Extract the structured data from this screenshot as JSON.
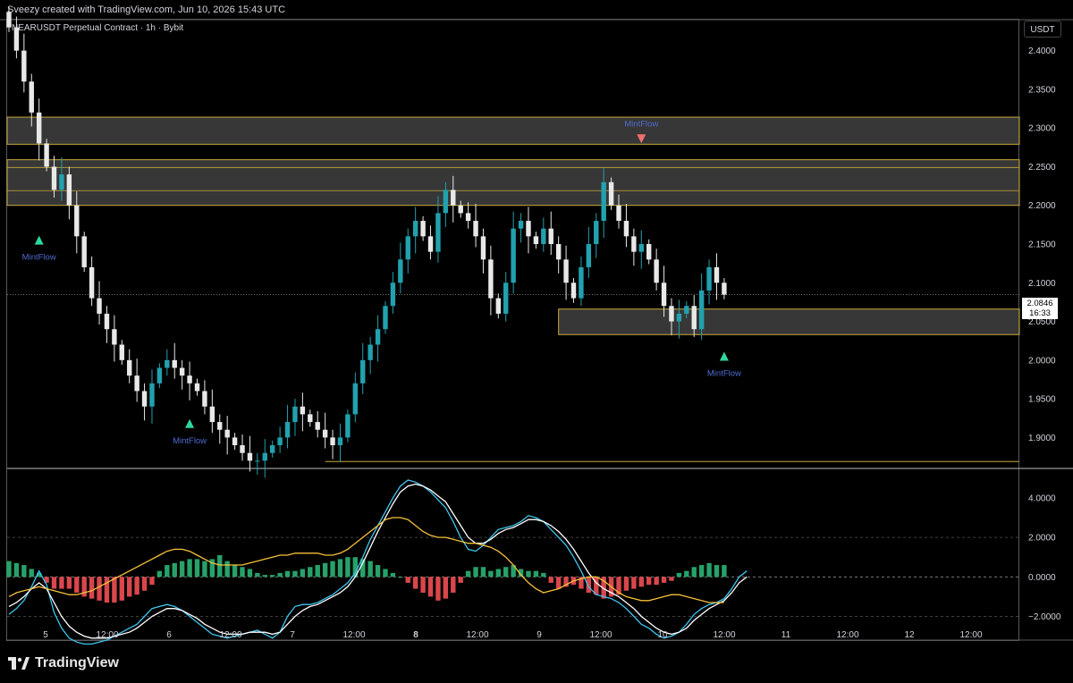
{
  "header": {
    "attribution": "Sveezy created with TradingView.com, Jun 10, 2026 15:43 UTC"
  },
  "chart": {
    "symbol_label": "NEARUSDT Perpetual Contract · 1h · Bybit",
    "currency": "USDT",
    "last_price": "2.0846",
    "countdown": "16:33",
    "colors": {
      "up": "#22a1ae",
      "down": "#e8e8e8",
      "zone": "#c8a93a",
      "macd_fast": "#3ec6f0",
      "macd_slow": "#ffffff",
      "signal": "#f7c23a",
      "hist_pos": "#26a269",
      "hist_neg": "#d9464c",
      "mint_up": "#2fd6a0",
      "mint_down": "#f07070",
      "mint_text": "#4f6bd1"
    }
  },
  "chart_data": [
    {
      "type": "candlestick",
      "title": "NEARUSDT Perpetual Contract · 1h · Bybit",
      "ylim": [
        1.86,
        2.44
      ],
      "y_ticks": [
        "2.4000",
        "2.3500",
        "2.3000",
        "2.2500",
        "2.2000",
        "2.1500",
        "2.1000",
        "2.0500",
        "2.0000",
        "1.9500",
        "1.9000"
      ],
      "x_ticks": [
        "5",
        "12:00",
        "6",
        "12:00",
        "7",
        "12:00",
        "8",
        "12:00",
        "9",
        "12:00",
        "10",
        "12:00",
        "11",
        "12:00",
        "12",
        "12:00"
      ],
      "close_path": [
        2.43,
        2.4,
        2.36,
        2.32,
        2.28,
        2.25,
        2.22,
        2.24,
        2.2,
        2.16,
        2.12,
        2.08,
        2.06,
        2.04,
        2.02,
        2.0,
        1.98,
        1.96,
        1.94,
        1.97,
        1.99,
        2.0,
        1.99,
        1.98,
        1.97,
        1.96,
        1.94,
        1.92,
        1.91,
        1.9,
        1.89,
        1.88,
        1.87,
        1.87,
        1.88,
        1.89,
        1.9,
        1.92,
        1.94,
        1.93,
        1.92,
        1.91,
        1.9,
        1.89,
        1.9,
        1.93,
        1.97,
        2.0,
        2.02,
        2.04,
        2.07,
        2.1,
        2.13,
        2.16,
        2.18,
        2.16,
        2.14,
        2.19,
        2.22,
        2.2,
        2.19,
        2.18,
        2.16,
        2.13,
        2.08,
        2.06,
        2.1,
        2.17,
        2.18,
        2.16,
        2.15,
        2.17,
        2.15,
        2.13,
        2.1,
        2.08,
        2.12,
        2.15,
        2.18,
        2.23,
        2.2,
        2.18,
        2.16,
        2.14,
        2.15,
        2.13,
        2.1,
        2.07,
        2.05,
        2.06,
        2.07,
        2.04,
        2.09,
        2.12,
        2.1,
        2.0846
      ],
      "zones": [
        {
          "top": 2.314,
          "bottom": 2.279
        },
        {
          "top": 2.259,
          "bottom": 2.2
        },
        {
          "top": 2.066,
          "bottom": 2.033
        }
      ],
      "support_line": 1.869,
      "signals": [
        {
          "label": "MintFlow",
          "direction": "up",
          "bar": 4,
          "price": 2.155
        },
        {
          "label": "MintFlow",
          "direction": "up",
          "bar": 24,
          "price": 1.918
        },
        {
          "label": "MintFlow",
          "direction": "down",
          "bar": 84,
          "price": 2.286
        },
        {
          "label": "MintFlow",
          "direction": "up",
          "bar": 95,
          "price": 2.005
        }
      ]
    },
    {
      "type": "line",
      "title": "",
      "ylim": [
        -3.2,
        5.4
      ],
      "y_ticks": [
        "4.0000",
        "2.0000",
        "0.0000",
        "−2.0000"
      ],
      "series": [
        {
          "values": [
            -1.9,
            -1.6,
            -1.2,
            -0.5,
            0.3,
            -0.4,
            -1.8,
            -2.6,
            -3.1,
            -3.3,
            -3.4,
            -3.4,
            -3.3,
            -3.2,
            -3.0,
            -2.8,
            -2.6,
            -2.4,
            -2.0,
            -1.6,
            -1.5,
            -1.4,
            -1.5,
            -1.7,
            -2.0,
            -2.3,
            -2.6,
            -2.9,
            -3.0,
            -3.1,
            -3.0,
            -2.9,
            -2.8,
            -2.7,
            -2.9,
            -3.1,
            -2.8,
            -2.0,
            -1.5,
            -1.4,
            -1.4,
            -1.3,
            -1.1,
            -0.9,
            -0.6,
            -0.3,
            0.2,
            1.0,
            1.9,
            2.6,
            3.3,
            4.0,
            4.6,
            4.9,
            4.8,
            4.6,
            4.3,
            3.9,
            3.5,
            2.8,
            2.0,
            1.4,
            1.3,
            1.6,
            2.0,
            2.4,
            2.5,
            2.6,
            2.8,
            3.1,
            3.0,
            2.8,
            2.4,
            2.0,
            1.6,
            1.0,
            0.3,
            -0.5,
            -0.9,
            -1.0,
            -1.1,
            -1.3,
            -1.6,
            -2.0,
            -2.4,
            -2.6,
            -2.9,
            -3.1,
            -3.0,
            -2.8,
            -2.4,
            -1.9,
            -1.6,
            -1.4,
            -1.3,
            -1.1,
            -0.6,
            0.0,
            0.3
          ]
        },
        {
          "values": [
            -1.5,
            -1.3,
            -1.0,
            -0.6,
            -0.3,
            -0.6,
            -1.3,
            -2.0,
            -2.5,
            -2.8,
            -3.0,
            -3.1,
            -3.1,
            -3.1,
            -3.0,
            -2.9,
            -2.8,
            -2.6,
            -2.3,
            -2.0,
            -1.8,
            -1.6,
            -1.6,
            -1.7,
            -1.9,
            -2.1,
            -2.4,
            -2.6,
            -2.8,
            -2.9,
            -2.9,
            -2.9,
            -2.8,
            -2.8,
            -2.8,
            -2.9,
            -2.8,
            -2.4,
            -2.0,
            -1.7,
            -1.5,
            -1.4,
            -1.2,
            -1.0,
            -0.8,
            -0.5,
            0.0,
            0.7,
            1.5,
            2.3,
            3.0,
            3.7,
            4.3,
            4.6,
            4.7,
            4.6,
            4.4,
            4.1,
            3.8,
            3.2,
            2.6,
            2.0,
            1.7,
            1.7,
            1.9,
            2.2,
            2.4,
            2.5,
            2.7,
            2.9,
            2.9,
            2.8,
            2.6,
            2.3,
            1.9,
            1.4,
            0.8,
            0.2,
            -0.3,
            -0.6,
            -0.8,
            -1.0,
            -1.3,
            -1.6,
            -2.0,
            -2.3,
            -2.6,
            -2.8,
            -2.9,
            -2.8,
            -2.6,
            -2.2,
            -1.9,
            -1.6,
            -1.4,
            -1.2,
            -0.8,
            -0.3,
            0.0
          ]
        },
        {
          "values": [
            -1.0,
            -0.8,
            -0.7,
            -0.6,
            -0.5,
            -0.6,
            -0.7,
            -0.8,
            -0.9,
            -0.9,
            -0.8,
            -0.7,
            -0.5,
            -0.3,
            -0.1,
            0.1,
            0.3,
            0.5,
            0.7,
            0.9,
            1.1,
            1.3,
            1.4,
            1.4,
            1.3,
            1.1,
            0.9,
            0.7,
            0.6,
            0.6,
            0.6,
            0.6,
            0.7,
            0.8,
            0.9,
            1.0,
            1.1,
            1.1,
            1.2,
            1.2,
            1.2,
            1.2,
            1.1,
            1.1,
            1.2,
            1.4,
            1.7,
            2.0,
            2.3,
            2.6,
            2.9,
            3.0,
            3.0,
            2.9,
            2.6,
            2.3,
            2.1,
            2.0,
            2.0,
            1.9,
            1.8,
            1.7,
            1.7,
            1.6,
            1.5,
            1.3,
            1.0,
            0.6,
            0.1,
            -0.3,
            -0.6,
            -0.8,
            -0.7,
            -0.6,
            -0.4,
            -0.2,
            -0.1,
            0.0,
            0.0,
            -0.2,
            -0.5,
            -0.8,
            -1.0,
            -1.1,
            -1.2,
            -1.2,
            -1.1,
            -1.0,
            -0.9,
            -0.9,
            -1.0,
            -1.1,
            -1.2,
            -1.3,
            -1.3,
            -1.3
          ]
        }
      ],
      "histogram": [
        0.8,
        0.7,
        0.6,
        0.4,
        0.2,
        -0.3,
        -0.6,
        -0.6,
        -0.6,
        -0.8,
        -1.0,
        -1.1,
        -1.2,
        -1.3,
        -1.3,
        -1.2,
        -1.0,
        -0.9,
        -0.7,
        -0.4,
        0.3,
        0.6,
        0.7,
        0.8,
        0.9,
        0.9,
        0.8,
        0.9,
        1.1,
        0.8,
        0.6,
        0.5,
        0.4,
        0.2,
        0.1,
        0.1,
        0.2,
        0.3,
        0.3,
        0.4,
        0.5,
        0.6,
        0.7,
        0.8,
        0.9,
        1.0,
        1.0,
        0.9,
        0.8,
        0.6,
        0.4,
        0.2,
        0.0,
        -0.3,
        -0.6,
        -0.8,
        -1.0,
        -1.2,
        -1.1,
        -0.8,
        -0.3,
        0.3,
        0.5,
        0.5,
        0.3,
        0.4,
        0.5,
        0.6,
        0.4,
        0.3,
        0.3,
        0.2,
        -0.3,
        -0.6,
        -0.5,
        -0.4,
        -0.6,
        -0.8,
        -0.9,
        -1.1,
        -1.0,
        -0.9,
        -0.7,
        -0.6,
        -0.5,
        -0.4,
        -0.4,
        -0.3,
        -0.2,
        0.2,
        0.3,
        0.5,
        0.6,
        0.7,
        0.6,
        0.6
      ]
    }
  ],
  "brand": {
    "name": "TradingView"
  }
}
